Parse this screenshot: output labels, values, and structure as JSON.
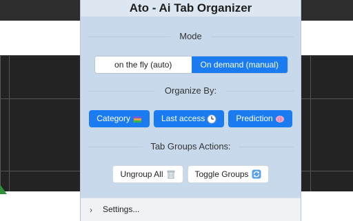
{
  "popup": {
    "title": "Ato - Ai Tab Organizer",
    "mode": {
      "heading": "Mode",
      "options": [
        "on the fly (auto)",
        "On demand (manual)"
      ],
      "selected": "On demand (manual)"
    },
    "organize": {
      "heading": "Organize By:",
      "buttons": [
        {
          "label": "Category",
          "icon": "books-icon"
        },
        {
          "label": "Last access",
          "icon": "clock-icon"
        },
        {
          "label": "Prediction",
          "icon": "brain-icon"
        }
      ]
    },
    "groups": {
      "heading": "Tab Groups Actions:",
      "buttons": [
        {
          "label": "Ungroup All",
          "icon": "trash-icon"
        },
        {
          "label": "Toggle Groups",
          "icon": "refresh-icon"
        }
      ]
    },
    "footer": {
      "settings_label": "Settings..."
    }
  },
  "colors": {
    "accent": "#1a7cf0",
    "panel": "#c9d9ec"
  }
}
